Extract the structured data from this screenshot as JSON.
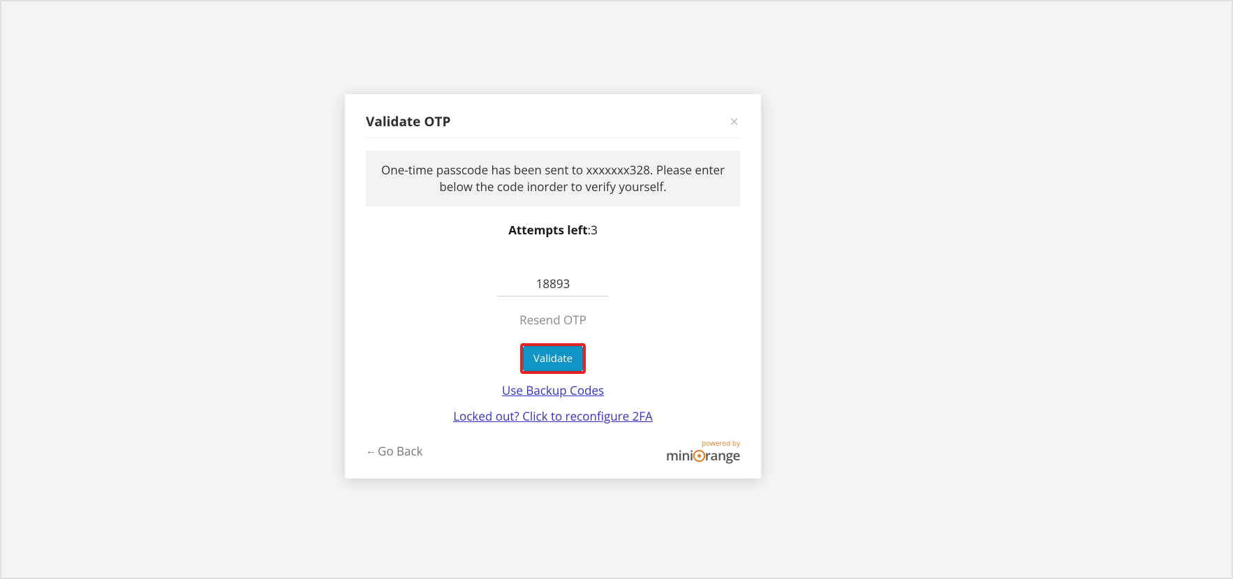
{
  "modal": {
    "title": "Validate OTP",
    "close": "×",
    "message": "One-time passcode has been sent to xxxxxxx328. Please enter below the code inorder to verify yourself.",
    "attempts_label": "Attempts left",
    "attempts_value": ":3",
    "otp_value": "18893",
    "resend": "Resend OTP",
    "validate": "Validate",
    "backup": "Use Backup Codes",
    "locked": "Locked out? Click to reconfigure 2FA",
    "go_back": "Go Back",
    "powered_by": "powered by",
    "brand_prefix": "mini",
    "brand_accent_char": "⬤",
    "brand_suffix": "range"
  }
}
